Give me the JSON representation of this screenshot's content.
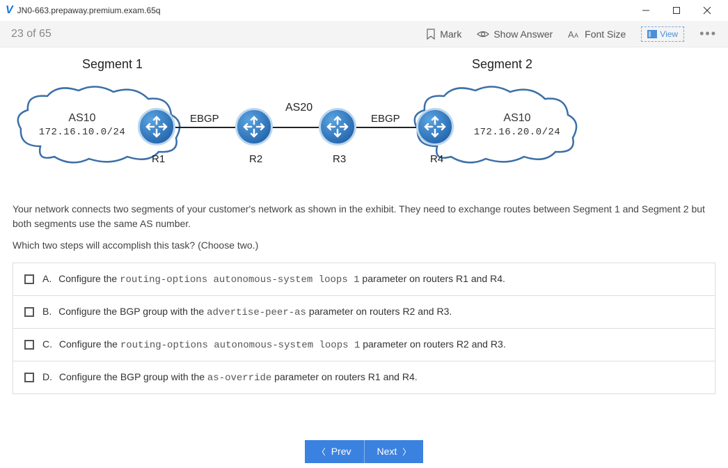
{
  "window": {
    "title": "JN0-663.prepaway.premium.exam.65q"
  },
  "toolbar": {
    "counter": "23 of 65",
    "mark": "Mark",
    "show_answer": "Show Answer",
    "font_size": "Font Size",
    "view": "View"
  },
  "diagram": {
    "segment1": "Segment 1",
    "segment2": "Segment 2",
    "cloud1": {
      "as": "AS10",
      "prefix": "172.16.10.0/24"
    },
    "cloud2": {
      "as": "AS10",
      "prefix": "172.16.20.0/24"
    },
    "as_center": "AS20",
    "ebgp1": "EBGP",
    "ebgp2": "EBGP",
    "r1": "R1",
    "r2": "R2",
    "r3": "R3",
    "r4": "R4"
  },
  "question": {
    "p1": "Your network connects two segments of your customer's network as shown in the exhibit. They need to exchange routes between Segment 1 and Segment 2 but both segments use the same AS number.",
    "p2": "Which two steps will accomplish this task? (Choose two.)"
  },
  "answers": {
    "a": {
      "letter": "A.",
      "pre": "Configure the ",
      "code": "routing-options autonomous-system loops 1",
      "post": " parameter on routers R1 and R4."
    },
    "b": {
      "letter": "B.",
      "pre": "Configure the BGP group with the ",
      "code": "advertise-peer-as",
      "post": " parameter on routers R2 and R3."
    },
    "c": {
      "letter": "C.",
      "pre": "Configure the ",
      "code": "routing-options autonomous-system loops 1",
      "post": " parameter on routers R2 and R3."
    },
    "d": {
      "letter": "D.",
      "pre": "Configure the BGP group with the ",
      "code": "as-override",
      "post": " parameter on routers R1 and R4."
    }
  },
  "footer": {
    "prev": "Prev",
    "next": "Next"
  }
}
